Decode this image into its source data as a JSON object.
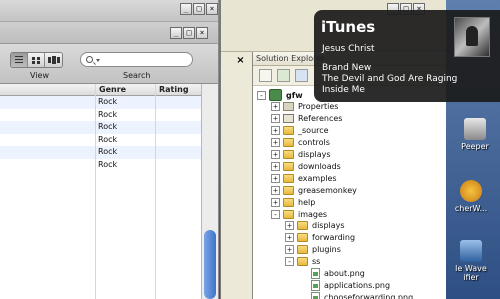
{
  "itunes": {
    "toolbar": {
      "view_label": "View",
      "search_label": "Search"
    },
    "columns": [
      "Genre",
      "Rating"
    ],
    "rows": [
      {
        "genre": "Rock",
        "rating": ""
      },
      {
        "genre": "Rock",
        "rating": ""
      },
      {
        "genre": "Rock",
        "rating": ""
      },
      {
        "genre": "Rock",
        "rating": ""
      },
      {
        "genre": "Rock",
        "rating": ""
      },
      {
        "genre": "Rock",
        "rating": ""
      }
    ],
    "window_buttons": [
      "_",
      "□",
      "×"
    ],
    "inner_buttons": [
      "_",
      "□",
      "×"
    ]
  },
  "solution_explorer": {
    "title": "Solution Explorer",
    "project": "gfw",
    "items": [
      {
        "label": "Properties",
        "type": "props",
        "indent": 1,
        "expander": "+"
      },
      {
        "label": "References",
        "type": "refs",
        "indent": 1,
        "expander": "+"
      },
      {
        "label": "_source",
        "type": "folder",
        "indent": 1,
        "expander": "+"
      },
      {
        "label": "controls",
        "type": "folder",
        "indent": 1,
        "expander": "+"
      },
      {
        "label": "displays",
        "type": "folder",
        "indent": 1,
        "expander": "+"
      },
      {
        "label": "downloads",
        "type": "folder",
        "indent": 1,
        "expander": "+"
      },
      {
        "label": "examples",
        "type": "folder",
        "indent": 1,
        "expander": "+"
      },
      {
        "label": "greasemonkey",
        "type": "folder",
        "indent": 1,
        "expander": "+"
      },
      {
        "label": "help",
        "type": "folder",
        "indent": 1,
        "expander": "+"
      },
      {
        "label": "images",
        "type": "folder",
        "indent": 1,
        "expander": "-"
      },
      {
        "label": "displays",
        "type": "folder",
        "indent": 2,
        "expander": "+"
      },
      {
        "label": "forwarding",
        "type": "folder",
        "indent": 2,
        "expander": "+"
      },
      {
        "label": "plugins",
        "type": "folder",
        "indent": 2,
        "expander": "+"
      },
      {
        "label": "ss",
        "type": "folder",
        "indent": 2,
        "expander": "-"
      },
      {
        "label": "about.png",
        "type": "file",
        "indent": 3,
        "expander": ""
      },
      {
        "label": "applications.png",
        "type": "file",
        "indent": 3,
        "expander": ""
      },
      {
        "label": "chooseforwarding.png",
        "type": "file",
        "indent": 3,
        "expander": ""
      }
    ]
  },
  "notification": {
    "title": "iTunes",
    "lines": [
      "Jesus Christ",
      "Brand New",
      "The Devil and God Are Raging",
      "Inside Me"
    ]
  },
  "desktop_icons": [
    {
      "label": "Peeper",
      "icon": "peeper-icon"
    },
    {
      "label": "cherW...",
      "icon": "app-icon"
    },
    {
      "label": "le Wave",
      "icon": "wave-icon"
    },
    {
      "label": "ifier",
      "icon": "notifier-icon"
    }
  ],
  "colors": {
    "notification_bg": "#1c1c1c",
    "row_alt": "#edf3fe",
    "folder": "#e6b93c"
  }
}
